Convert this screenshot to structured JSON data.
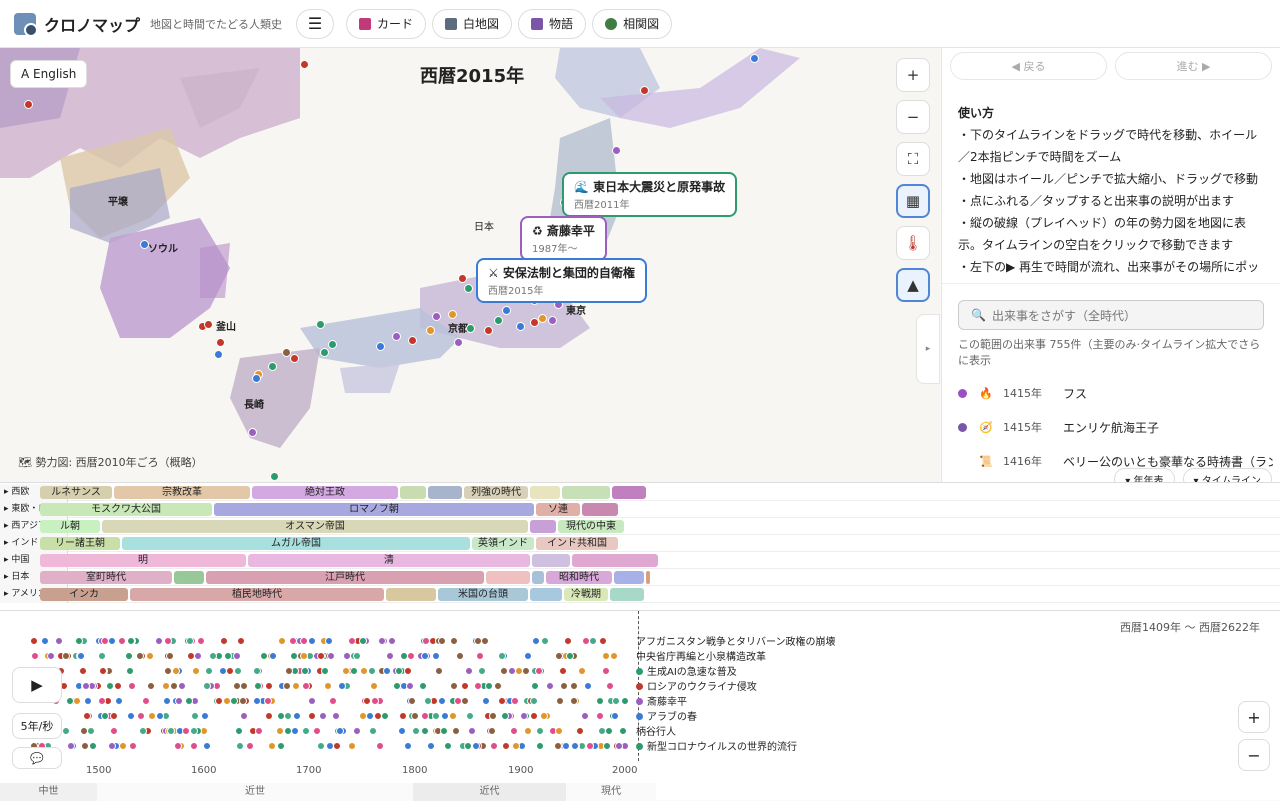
{
  "header": {
    "title": "クロノマップ",
    "subtitle": "地図と時間でたどる人類史",
    "menu_icon": "☰",
    "tabs": [
      {
        "label": "カード",
        "color": "#c0397a"
      },
      {
        "label": "白地図",
        "color": "#5a6c7e"
      },
      {
        "label": "物語",
        "color": "#7a55a8"
      },
      {
        "label": "相関図",
        "color": "#3f7d45"
      }
    ]
  },
  "map": {
    "lang_button": "A English",
    "year_title": "西暦2015年",
    "zoom_in": "+",
    "zoom_out": "−",
    "fullscreen": "⛶",
    "legend_note": "🗺 勢力図: 西暦2010年ごろ（概略）",
    "place_labels": [
      {
        "text": "平壌"
      },
      {
        "text": "ソウル"
      },
      {
        "text": "釜山"
      },
      {
        "text": "長崎"
      },
      {
        "text": "東京"
      },
      {
        "text": "京都"
      },
      {
        "text": "日本"
      }
    ],
    "callouts": [
      {
        "title": "🌊 東日本大震災と原発事故",
        "sub": "西暦2011年",
        "color": "#2e9b6c"
      },
      {
        "title": "♻ 斎藤幸平",
        "sub": "1987年〜",
        "color": "#9b5fc0"
      },
      {
        "title": "⚔ 安保法制と集団的自衛権",
        "sub": "西暦2015年",
        "color": "#3a7bd5"
      }
    ]
  },
  "sidebar": {
    "back": "◀ 戻る",
    "forward": "進む ▶",
    "help_title": "使い方",
    "help_lines": [
      "・下のタイムラインをドラッグで時代を移動、ホイール／2本指ピンチで時間をズーム",
      "・地図はホイール／ピンチで拡大縮小、ドラッグで移動",
      "・点にふれる／タップすると出来事の説明が出ます",
      "・縦の破線（プレイヘッド）の年の勢力図を地図に表示。タイムラインの空白をクリックで移動できます",
      "・左下の▶ 再生で時間が流れ、出来事がその場所にポップア"
    ],
    "search_placeholder": "出来事をさがす（全時代）",
    "count_text": "この範囲の出来事 755件（主要のみ·タイムライン拡大でさらに表示",
    "events": [
      {
        "year": "1415年",
        "title": "フス",
        "dot": "#9b4fc0",
        "icon": "🔥"
      },
      {
        "year": "1415年",
        "title": "エンリケ航海王子",
        "dot": "#7a55a8",
        "icon": "🧭"
      },
      {
        "year": "1416年",
        "title": "ベリー公のいとも豪華なる時祷書（ラン…",
        "dot": "",
        "icon": "📜"
      }
    ],
    "tab_chronology": "▾ 年年表",
    "tab_timeline": "▾ タイムライン",
    "collapse": "▸"
  },
  "bands": {
    "regions": [
      "西欧",
      "東欧・ロシア",
      "西アジア",
      "インド",
      "中国",
      "日本",
      "アメリカ大陸"
    ],
    "periods": [
      [
        {
          "label": "ルネサンス",
          "color": "#d6cfae"
        },
        {
          "label": "宗教改革",
          "color": "#e2c8a8"
        },
        {
          "label": "絶対王政",
          "color": "#d4a8e0"
        },
        {
          "label": "",
          "color": "#c8dcb0"
        },
        {
          "label": "",
          "color": "#a8b4cc"
        },
        {
          "label": "列強の時代",
          "color": "#d8d0b8"
        },
        {
          "label": "",
          "color": "#e8e4c0"
        },
        {
          "label": "",
          "color": "#c8e0b8"
        },
        {
          "label": "",
          "color": "#c080c0"
        }
      ],
      [
        {
          "label": "モスクワ大公国",
          "color": "#c8e8b8"
        },
        {
          "label": "ロマノフ朝",
          "color": "#a8a8e0"
        },
        {
          "label": "ソ連",
          "color": "#e0b0a8"
        },
        {
          "label": "",
          "color": "#c888b0"
        }
      ],
      [
        {
          "label": "ル朝",
          "color": "#c8f0c0"
        },
        {
          "label": "オスマン帝国",
          "color": "#d8d8b8"
        },
        {
          "label": "",
          "color": "#c8a0d8"
        },
        {
          "label": "現代の中東",
          "color": "#c8e8c0"
        }
      ],
      [
        {
          "label": "リー諸王朝",
          "color": "#c8e0a8"
        },
        {
          "label": "ムガル帝国",
          "color": "#a8e0e0"
        },
        {
          "label": "英領インド",
          "color": "#c8e8c8"
        },
        {
          "label": "インド共和国",
          "color": "#e8c8c0"
        }
      ],
      [
        {
          "label": "明",
          "color": "#f0b8d8"
        },
        {
          "label": "清",
          "color": "#e8b8e0"
        },
        {
          "label": "",
          "color": "#d0c0e0"
        },
        {
          "label": "",
          "color": "#e0a8d0"
        }
      ],
      [
        {
          "label": "室町時代",
          "color": "#e0b0c8"
        },
        {
          "label": "",
          "color": "#98c898"
        },
        {
          "label": "江戸時代",
          "color": "#d8a0b0"
        },
        {
          "label": "",
          "color": "#f0c0c0"
        },
        {
          "label": "",
          "color": "#a8c0d8"
        },
        {
          "label": "昭和時代",
          "color": "#d8a8d8"
        },
        {
          "label": "",
          "color": "#a8b0e8"
        },
        {
          "label": "",
          "color": "#d8a080"
        }
      ],
      [
        {
          "label": "インカ",
          "color": "#c8a090"
        },
        {
          "label": "植民地時代",
          "color": "#d8a8a8"
        },
        {
          "label": "",
          "color": "#d8c8a0"
        },
        {
          "label": "米国の台頭",
          "color": "#a8c8d8"
        },
        {
          "label": "",
          "color": "#a8c8e0"
        },
        {
          "label": "冷戦期",
          "color": "#d8e8b8"
        },
        {
          "label": "",
          "color": "#a8d8c8"
        }
      ]
    ]
  },
  "timeline": {
    "range_text": "西暦1409年 〜 西暦2622年",
    "play": "▶",
    "speed": "5年/秒",
    "chat": "💬",
    "zoom_in": "+",
    "zoom_out": "−",
    "labels": [
      {
        "text": "アフガニスタン戦争とタリバーン政権の崩壊",
        "dot": ""
      },
      {
        "text": "中央省庁再編と小泉構造改革",
        "dot": ""
      },
      {
        "text": "生成AIの急速な普及",
        "dot": "#2e9b6c"
      },
      {
        "text": "ロシアのウクライナ侵攻",
        "dot": "#c0392b"
      },
      {
        "text": "斎藤幸平",
        "dot": "#9b5fc0"
      },
      {
        "text": "アラブの春",
        "dot": "#3a7bd5"
      },
      {
        "text": "柄谷行人",
        "dot": ""
      },
      {
        "text": "新型コロナウイルスの世界的流行",
        "dot": "#2e9b6c"
      }
    ],
    "ticks": [
      "1500",
      "1600",
      "1700",
      "1800",
      "1900",
      "2000"
    ],
    "eras": [
      "中世",
      "近世",
      "近代",
      "現代"
    ]
  }
}
